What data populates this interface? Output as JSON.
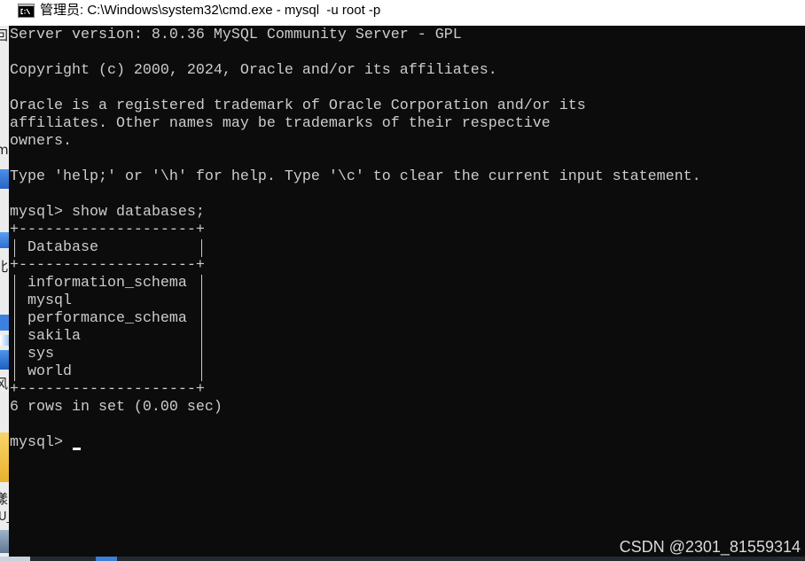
{
  "window": {
    "title": "管理员: C:\\Windows\\system32\\cmd.exe - mysql  -u root -p",
    "icon": "cmd-icon"
  },
  "console": {
    "banner": {
      "server_version": "Server version: 8.0.36 MySQL Community Server - GPL",
      "copyright": "Copyright (c) 2000, 2024, Oracle and/or its affiliates.",
      "trademark": [
        "Oracle is a registered trademark of Oracle Corporation and/or its",
        "affiliates. Other names may be trademarks of their respective",
        "owners."
      ],
      "help_hint": "Type 'help;' or '\\h' for help. Type '\\c' to clear the current input statement."
    },
    "prompt": "mysql>",
    "history": [
      {
        "command": "show databases;",
        "result": {
          "border": "+--------------------+",
          "column": "Database",
          "rows": [
            "information_schema",
            "mysql",
            "performance_schema",
            "sakila",
            "sys",
            "world"
          ],
          "summary": "6 rows in set (0.00 sec)"
        }
      }
    ],
    "current_input": ""
  },
  "desktop_peek": {
    "labels": [
      "回",
      "m",
      "北",
      "风",
      "漾",
      "U_"
    ]
  },
  "watermark": "CSDN @2301_81559314",
  "theme": {
    "titlebar_bg": "#ffffff",
    "titlebar_fg": "#000000",
    "console_bg": "#0c0c0c",
    "console_fg": "#cccccc",
    "cursor": "#ffffff",
    "watermark_fg": "#d9d9d9"
  }
}
